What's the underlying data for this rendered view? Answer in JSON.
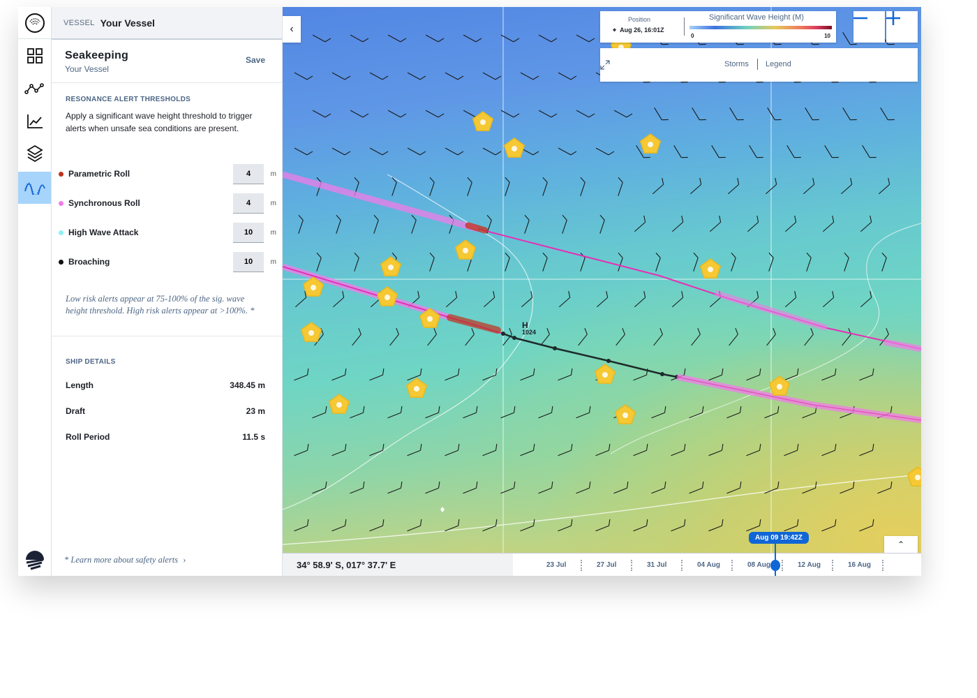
{
  "vessel": {
    "label": "VESSEL",
    "name": "Your Vessel"
  },
  "rail": {
    "items": [
      "dashboard",
      "route",
      "chart",
      "layers",
      "seakeeping"
    ]
  },
  "section": {
    "title": "Seakeeping",
    "subtitle": "Your Vessel",
    "save_label": "Save"
  },
  "resonance": {
    "heading": "RESONANCE ALERT THRESHOLDS",
    "description": "Apply a significant wave height threshold to trigger alerts when unsafe sea conditions are present.",
    "thresholds": [
      {
        "label": "Parametric Roll",
        "value": "4",
        "unit": "m",
        "color": "#c0321b"
      },
      {
        "label": "Synchronous Roll",
        "value": "4",
        "unit": "m",
        "color": "#f27ce6"
      },
      {
        "label": "High Wave Attack",
        "value": "10",
        "unit": "m",
        "color": "#8ff0f5"
      },
      {
        "label": "Broaching",
        "value": "10",
        "unit": "m",
        "color": "#111111"
      }
    ],
    "note": "Low risk alerts appear at 75-100% of the sig. wave height threshold. High risk alerts appear at >100%. *"
  },
  "ship": {
    "heading": "SHIP DETAILS",
    "rows": [
      {
        "label": "Length",
        "value": "348.45 m"
      },
      {
        "label": "Draft",
        "value": "23 m"
      },
      {
        "label": "Roll Period",
        "value": "11.5 s"
      }
    ]
  },
  "learn_more": "* Learn more about safety alerts",
  "map": {
    "position_label": "Position",
    "position_value": "Aug 26, 16:01Z",
    "legend_title": "Significant Wave Height (M)",
    "legend_min": "0",
    "legend_max": "10",
    "storms_label": "Storms",
    "legend_label": "Legend",
    "pressure_label": "H",
    "pressure_value": "1024",
    "coordinates": "34° 58.9' S, 017° 37.7' E",
    "timeline": [
      "23 Jul",
      "27 Jul",
      "31 Jul",
      "04 Aug",
      "08 Aug",
      "12 Aug",
      "16 Aug"
    ],
    "current_time": "Aug 09 19:42Z",
    "colors": {
      "route": "#e62fb4",
      "alert_pink": "#f07ce8",
      "alert_red": "#c0321b",
      "storm": "#f5c834",
      "accent": "#1066d6"
    }
  }
}
